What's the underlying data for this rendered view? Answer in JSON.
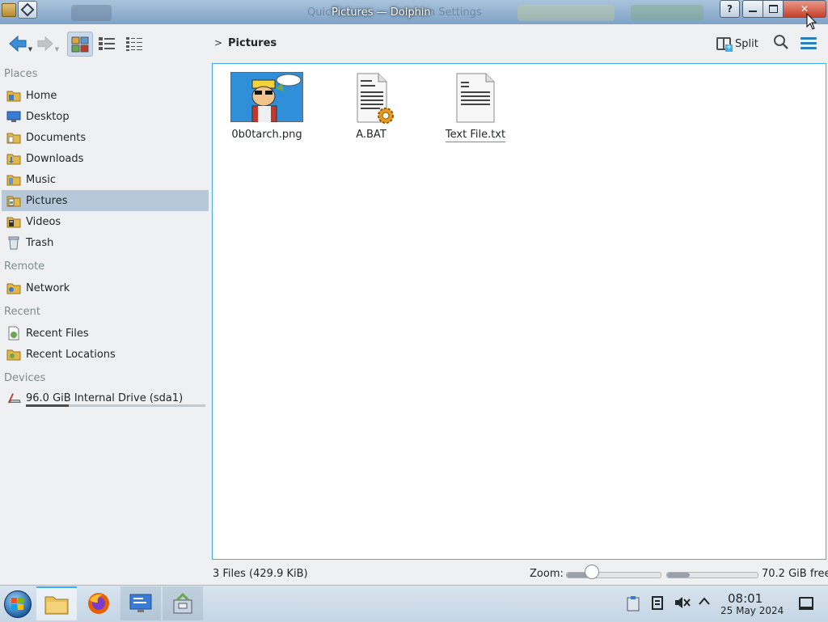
{
  "window": {
    "title": "Pictures — Dolphin",
    "ghost_title_left": "Quic",
    "ghost_title_right": "n Settings"
  },
  "toolbar": {
    "breadcrumb": "Pictures",
    "split_label": "Split"
  },
  "sidebar": {
    "places_title": "Places",
    "places": [
      {
        "label": "Home",
        "icon": "home-folder-icon"
      },
      {
        "label": "Desktop",
        "icon": "desktop-folder-icon"
      },
      {
        "label": "Documents",
        "icon": "documents-folder-icon"
      },
      {
        "label": "Downloads",
        "icon": "downloads-folder-icon"
      },
      {
        "label": "Music",
        "icon": "music-folder-icon"
      },
      {
        "label": "Pictures",
        "icon": "pictures-folder-icon",
        "active": true
      },
      {
        "label": "Videos",
        "icon": "videos-folder-icon"
      },
      {
        "label": "Trash",
        "icon": "trash-icon"
      }
    ],
    "remote_title": "Remote",
    "remote": [
      {
        "label": "Network",
        "icon": "network-folder-icon"
      }
    ],
    "recent_title": "Recent",
    "recent": [
      {
        "label": "Recent Files",
        "icon": "recent-files-icon"
      },
      {
        "label": "Recent Locations",
        "icon": "recent-locations-icon"
      }
    ],
    "devices_title": "Devices",
    "devices": [
      {
        "label": "96.0 GiB Internal Drive (sda1)",
        "icon": "drive-icon",
        "usage_fraction": 0.24
      }
    ]
  },
  "files": [
    {
      "name": "0b0tarch.png",
      "type": "image"
    },
    {
      "name": "A.BAT",
      "type": "batch-script"
    },
    {
      "name": "Text File.txt",
      "type": "text",
      "selected_underline": true
    }
  ],
  "status": {
    "summary": "3 Files (429.9 KiB)",
    "zoom_label": "Zoom:",
    "zoom_fraction": 0.28,
    "free_space": "70.2 GiB free",
    "free_used_fraction": 0.25
  },
  "taskbar": {
    "apps": [
      "file-manager-icon",
      "firefox-icon",
      "system-settings-icon",
      "package-manager-icon"
    ],
    "time": "08:01",
    "date": "25 May 2024"
  },
  "colors": {
    "accent": "#3daee9",
    "selection": "#b7c9d8",
    "close_button": "#c5402c"
  }
}
